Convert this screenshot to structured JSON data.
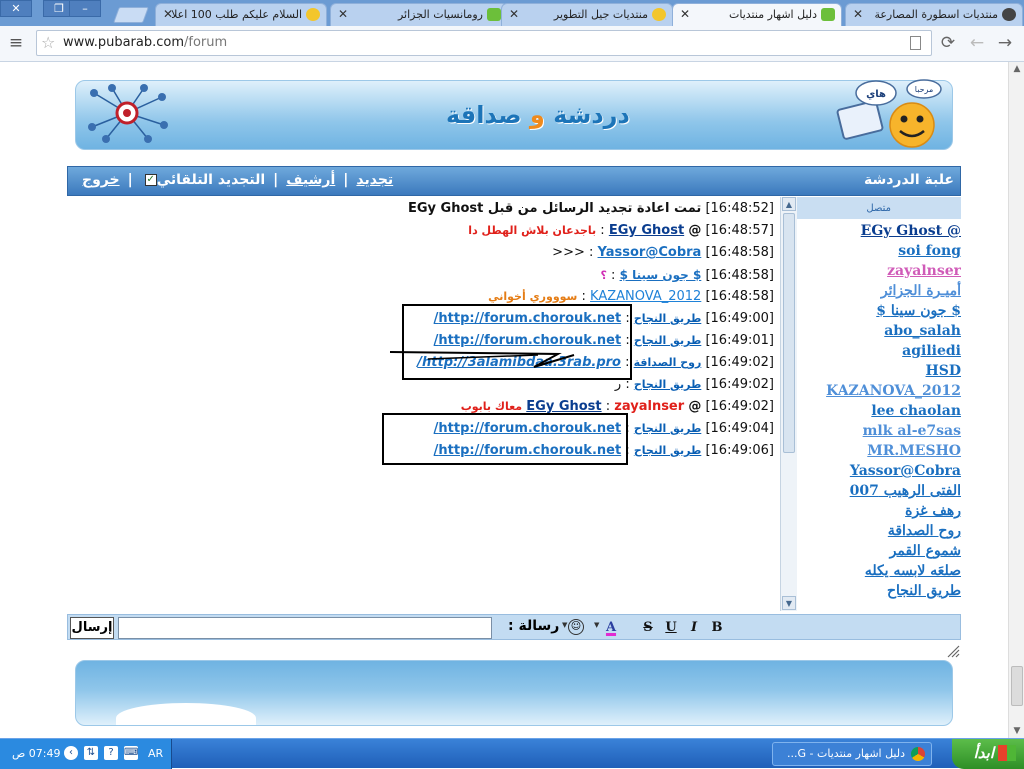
{
  "browser": {
    "tabs": [
      {
        "title": "منتديات اسطورة المصارعة"
      },
      {
        "title": "دليل اشهار منتديات"
      },
      {
        "title": "منتديات جيل التطوير"
      },
      {
        "title": "رومانسيات الجزائر"
      },
      {
        "title": "السلام عليكم طلب 100 اعلا"
      }
    ],
    "url_host": "www.pubarab.com",
    "url_path": "/forum"
  },
  "banner": {
    "title_a": "دردشة",
    "title_and": "و",
    "title_b": "صداقة",
    "bubble_welcome": "مرحبا",
    "bubble_hi": "هاي"
  },
  "chat": {
    "title": "علبة الدردشة",
    "links": {
      "refresh": "تجديد",
      "archive": "أرشيف",
      "auto_refresh": "التجديد التلقائي",
      "logout": "خروج"
    },
    "online_header": "متصل",
    "messages": [
      {
        "time": "[16:48:52]",
        "system": "تمت اعادة تجديد الرسائل من قبل EGy Ghost"
      },
      {
        "time": "[16:48:57]",
        "prefix": "@",
        "user": "EGy Ghost",
        "text": "باجدعان بلاش الهطل دا"
      },
      {
        "time": "[16:48:58]",
        "user": "Yassor@Cobra",
        "sep": ":",
        "text": "<<<"
      },
      {
        "time": "[16:48:58]",
        "user": "$ جون سينا $",
        "sep": ":",
        "text": "؟"
      },
      {
        "time": "[16:48:58]",
        "user": "KAZANOVA_2012",
        "sep": ":",
        "text": "سوووري أخواني"
      },
      {
        "time": "[16:49:00]",
        "user": "طريق النجاح",
        "sep": ":",
        "link": "http://forum.chorouk.net/"
      },
      {
        "time": "[16:49:01]",
        "user": "طريق النجاح",
        "sep": ":",
        "link": "http://forum.chorouk.net/"
      },
      {
        "time": "[16:49:02]",
        "user": "روح الصداقة",
        "sep": ":",
        "link": "http://3alamibdaa.3rab.pro/"
      },
      {
        "time": "[16:49:02]",
        "user": "طريق النجاح",
        "sep": ":",
        "text": "ر"
      },
      {
        "time": "[16:49:02]",
        "prefix": "@",
        "user": "EGy Ghost",
        "sep": ":",
        "target": "zayalnser",
        "text": "معاك بابوب"
      },
      {
        "time": "[16:49:04]",
        "user": "طريق النجاح",
        "sep": ":",
        "link": "http://forum.chorouk.net/"
      },
      {
        "time": "[16:49:06]",
        "user": "طريق النجاح",
        "sep": ":",
        "link": "http://forum.chorouk.net/"
      }
    ],
    "users": [
      {
        "name": "EGy Ghost @",
        "color": "#0a3d8f"
      },
      {
        "name": "soi fong",
        "color": "#1a6fc0"
      },
      {
        "name": "zayalnser",
        "color": "#d05bb8"
      },
      {
        "name": "أميـرة الجزائر",
        "color": "#4f8fd8"
      },
      {
        "name": "$ جون سينا $",
        "color": "#1a6fc0"
      },
      {
        "name": "abo_salah",
        "color": "#1a6fc0"
      },
      {
        "name": "agiliedi",
        "color": "#1a6fc0"
      },
      {
        "name": "HSD",
        "color": "#1a6fc0"
      },
      {
        "name": "KAZANOVA_2012",
        "color": "#4f8fd8"
      },
      {
        "name": "lee chaolan",
        "color": "#1a6fc0"
      },
      {
        "name": "mlk al-e7sas",
        "color": "#4f8fd8"
      },
      {
        "name": "MR.MESHO",
        "color": "#4f8fd8"
      },
      {
        "name": "Yassor@Cobra",
        "color": "#1a6fc0"
      },
      {
        "name": "الفتى الرهيب 007",
        "color": "#1a6fc0"
      },
      {
        "name": "رهف غزة",
        "color": "#1a6fc0"
      },
      {
        "name": "روح الصداقة",
        "color": "#1a6fc0"
      },
      {
        "name": "شموع القمر",
        "color": "#1a6fc0"
      },
      {
        "name": "صلعَه لابسه يكله",
        "color": "#1a6fc0"
      },
      {
        "name": "طريق النجاح",
        "color": "#1a6fc0"
      }
    ],
    "input": {
      "label": "رسالة :",
      "send": "إرسال",
      "bold": "B",
      "italic": "I",
      "underline": "U",
      "strike": "S",
      "color": "A"
    }
  },
  "taskbar": {
    "start": "ابدأ",
    "task": "دليل اشهار منتديات - G...",
    "clock": "07:49 ص",
    "lang": "AR"
  }
}
